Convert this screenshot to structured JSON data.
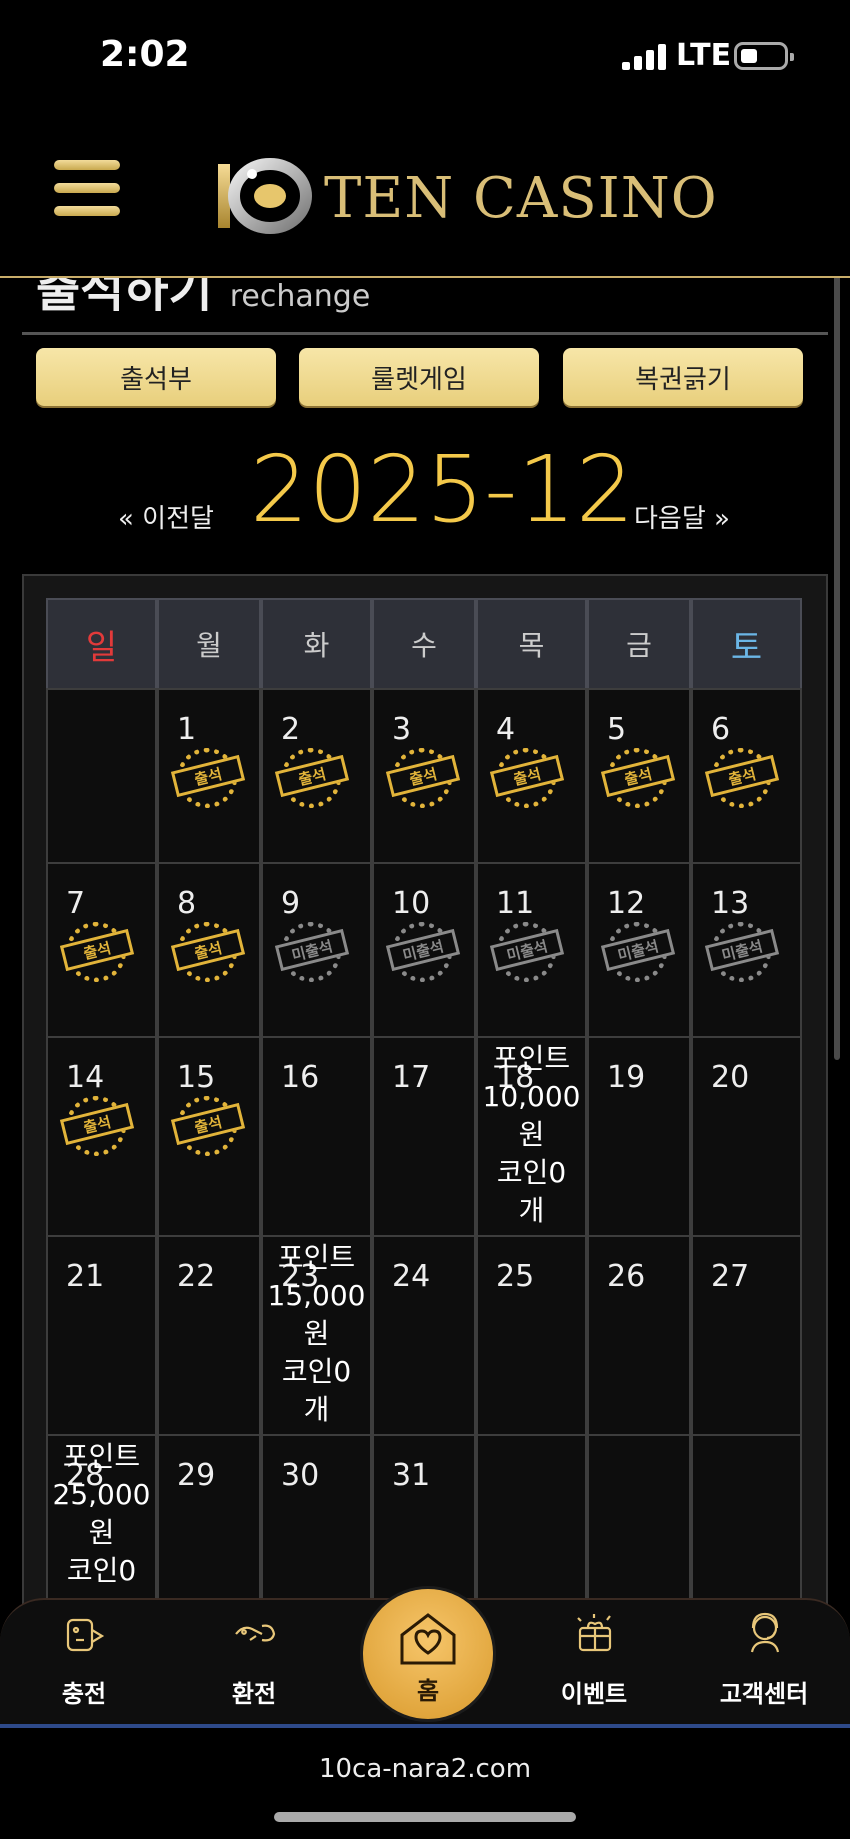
{
  "status_bar": {
    "time": "2:02",
    "network": "LTE"
  },
  "header": {
    "brand": "TEN CASINO"
  },
  "page": {
    "title_ko": "출석하기",
    "title_en": "rechange"
  },
  "tabs": [
    {
      "label": "출석부"
    },
    {
      "label": "룰렛게임"
    },
    {
      "label": "복권긁기"
    }
  ],
  "month_nav": {
    "prev": "« 이전달",
    "current": "2025-12",
    "next": "다음달 »"
  },
  "calendar": {
    "weekdays": [
      "일",
      "월",
      "화",
      "수",
      "목",
      "금",
      "토"
    ],
    "stamp_present": "출석",
    "stamp_absent": "미출석",
    "weeks": [
      [
        {
          "day": ""
        },
        {
          "day": "1",
          "stamp": "present"
        },
        {
          "day": "2",
          "stamp": "present"
        },
        {
          "day": "3",
          "stamp": "present"
        },
        {
          "day": "4",
          "stamp": "present"
        },
        {
          "day": "5",
          "stamp": "present"
        },
        {
          "day": "6",
          "stamp": "present"
        }
      ],
      [
        {
          "day": "7",
          "stamp": "present"
        },
        {
          "day": "8",
          "stamp": "present"
        },
        {
          "day": "9",
          "stamp": "absent"
        },
        {
          "day": "10",
          "stamp": "absent"
        },
        {
          "day": "11",
          "stamp": "absent"
        },
        {
          "day": "12",
          "stamp": "absent"
        },
        {
          "day": "13",
          "stamp": "absent"
        }
      ],
      [
        {
          "day": "14",
          "stamp": "present"
        },
        {
          "day": "15",
          "stamp": "present"
        },
        {
          "day": "16"
        },
        {
          "day": "17"
        },
        {
          "day": "18",
          "reward": [
            "포인트",
            "10,000",
            "원",
            "코인0",
            "개"
          ]
        },
        {
          "day": "19"
        },
        {
          "day": "20"
        }
      ],
      [
        {
          "day": "21"
        },
        {
          "day": "22"
        },
        {
          "day": "23",
          "reward": [
            "포인트",
            "15,000",
            "원",
            "코인0",
            "개"
          ]
        },
        {
          "day": "24"
        },
        {
          "day": "25"
        },
        {
          "day": "26"
        },
        {
          "day": "27"
        }
      ],
      [
        {
          "day": "28",
          "reward": [
            "포인트",
            "25,000",
            "원",
            "코인0"
          ]
        },
        {
          "day": "29"
        },
        {
          "day": "30"
        },
        {
          "day": "31"
        },
        {
          "day": ""
        },
        {
          "day": ""
        },
        {
          "day": ""
        }
      ]
    ]
  },
  "bottom_nav": {
    "items": [
      {
        "label": "충전",
        "icon": "charge-icon"
      },
      {
        "label": "환전",
        "icon": "exchange-icon"
      },
      {
        "label": "홈",
        "icon": "home-heart-icon"
      },
      {
        "label": "이벤트",
        "icon": "gift-icon"
      },
      {
        "label": "고객센터",
        "icon": "support-icon"
      }
    ]
  },
  "url_bar": {
    "url": "10ca-nara2.com"
  },
  "colors": {
    "accent": "#f4c94a",
    "button_bg": "#f0dc93",
    "sunday": "#e23a3a",
    "saturday": "#6bb6e6"
  }
}
